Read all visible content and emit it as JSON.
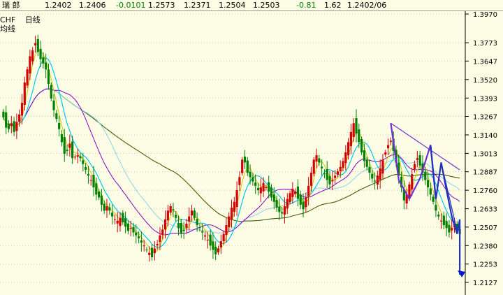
{
  "header": {
    "symbol": "瑞  郎",
    "price1": "1.2402",
    "price2": "1.2406",
    "change": "-0.0101",
    "open": "1.2573",
    "low": "1.2371",
    "high": "1.2504",
    "close": "1.2503",
    "pct": "-0.81",
    "vol": "1.62",
    "date": "1.2402/06"
  },
  "labels": {
    "pair": "CHF",
    "period": "日线",
    "ma": "均线"
  },
  "colors": {
    "background": "#fdfde6",
    "up": "#d40000",
    "down": "#008000",
    "ma_yellow": "#c8c800",
    "ma_cyan": "#00c8e6",
    "ma_purple": "#8000c8",
    "ma_lightcyan": "#8cd2e6",
    "ma_darkgreen": "#406000",
    "pattern_purple": "#7030d0",
    "pattern_blue": "#2030c0",
    "arrow_blue": "#0018d0"
  },
  "chart_data": {
    "type": "candlestick",
    "ylim": [
      1.205,
      1.398
    ],
    "yticks": [
      1.397,
      1.3773,
      1.3647,
      1.352,
      1.3393,
      1.3267,
      1.314,
      1.3013,
      1.2887,
      1.276,
      1.2633,
      1.2507,
      1.238,
      1.2253,
      1.2127
    ],
    "ytick_labels": [
      "1.3970",
      "1.3773",
      "1.3647",
      "1.3520",
      "1.3393",
      "1.3267",
      "1.3140",
      "1.3013",
      "1.2887",
      "1.2760",
      "1.2633",
      "1.2507",
      "1.2380",
      "1.2253",
      "1.2127"
    ],
    "closes": [
      1.326,
      1.319,
      1.318,
      1.322,
      1.316,
      1.323,
      1.328,
      1.336,
      1.35,
      1.359,
      1.368,
      1.372,
      1.377,
      1.371,
      1.366,
      1.363,
      1.359,
      1.349,
      1.339,
      1.331,
      1.325,
      1.318,
      1.309,
      1.301,
      1.303,
      1.308,
      1.298,
      1.299,
      1.3,
      1.298,
      1.294,
      1.29,
      1.286,
      1.283,
      1.278,
      1.273,
      1.271,
      1.266,
      1.262,
      1.265,
      1.262,
      1.258,
      1.256,
      1.255,
      1.257,
      1.254,
      1.251,
      1.248,
      1.25,
      1.247,
      1.245,
      1.243,
      1.24,
      1.238,
      1.235,
      1.233,
      1.23,
      1.236,
      1.239,
      1.245,
      1.249,
      1.256,
      1.262,
      1.265,
      1.262,
      1.257,
      1.25,
      1.246,
      1.248,
      1.253,
      1.258,
      1.262,
      1.257,
      1.252,
      1.25,
      1.247,
      1.245,
      1.242,
      1.238,
      1.235,
      1.232,
      1.236,
      1.241,
      1.246,
      1.252,
      1.258,
      1.264,
      1.268,
      1.276,
      1.285,
      1.297,
      1.295,
      1.288,
      1.285,
      1.282,
      1.279,
      1.276,
      1.278,
      1.281,
      1.278,
      1.275,
      1.271,
      1.268,
      1.264,
      1.261,
      1.26,
      1.265,
      1.27,
      1.274,
      1.277,
      1.275,
      1.27,
      1.266,
      1.263,
      1.271,
      1.279,
      1.288,
      1.297,
      1.3,
      1.295,
      1.291,
      1.287,
      1.283,
      1.28,
      1.283,
      1.286,
      1.289,
      1.292,
      1.296,
      1.302,
      1.309,
      1.316,
      1.322,
      1.315,
      1.309,
      1.302,
      1.296,
      1.292,
      1.288,
      1.284,
      1.282,
      1.286,
      1.291,
      1.297,
      1.302,
      1.307,
      1.31,
      1.303,
      1.295,
      1.286,
      1.278,
      1.269,
      1.273,
      1.28,
      1.287,
      1.294,
      1.298,
      1.293,
      1.288,
      1.283,
      1.278,
      1.273,
      1.268,
      1.262,
      1.258,
      1.255,
      1.252,
      1.25,
      1.247,
      1.25,
      1.253,
      1.25,
      1.246
    ],
    "pattern_lines": {
      "purple_zigzag": [
        [
          1.322,
          0
        ],
        [
          1.283,
          1
        ],
        [
          1.27,
          2
        ],
        [
          1.284,
          3
        ],
        [
          1.307,
          4
        ],
        [
          1.27,
          5
        ]
      ],
      "blue_zigzag": [
        [
          1.307,
          0
        ],
        [
          1.27,
          1
        ],
        [
          1.295,
          2
        ],
        [
          1.276,
          3
        ],
        [
          1.258,
          4
        ],
        [
          1.246,
          5
        ],
        [
          1.256,
          6
        ],
        [
          1.218,
          7
        ]
      ],
      "upper_trend": [
        [
          1.322,
          0
        ],
        [
          1.29,
          1
        ]
      ],
      "blue_trend": [
        [
          1.295,
          0
        ],
        [
          1.248,
          1
        ]
      ]
    }
  }
}
